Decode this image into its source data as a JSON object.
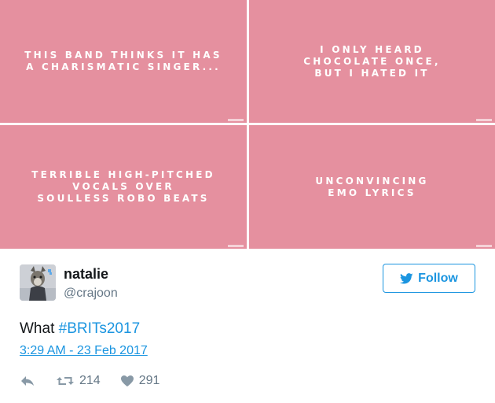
{
  "media": {
    "tiles": [
      {
        "text": "THIS BAND THINKS IT HAS\nA CHARISMATIC SINGER..."
      },
      {
        "text": "I ONLY HEARD\nCHOCOLATE ONCE,\nBUT I HATED IT"
      },
      {
        "text": "TERRIBLE HIGH-PITCHED\nVOCALS OVER\nSOULLESS ROBO BEATS"
      },
      {
        "text": "UNCONVINCING\nEMO LYRICS"
      }
    ],
    "tile_color": "#e5909f"
  },
  "tweet": {
    "name": "natalie",
    "handle": "@crajoon",
    "follow_label": "Follow",
    "text_prefix": "What ",
    "hashtag": "#BRITs2017",
    "timestamp": "3:29 AM - 23 Feb 2017",
    "retweet_count": "214",
    "like_count": "291",
    "accent_color": "#1b95e0"
  }
}
